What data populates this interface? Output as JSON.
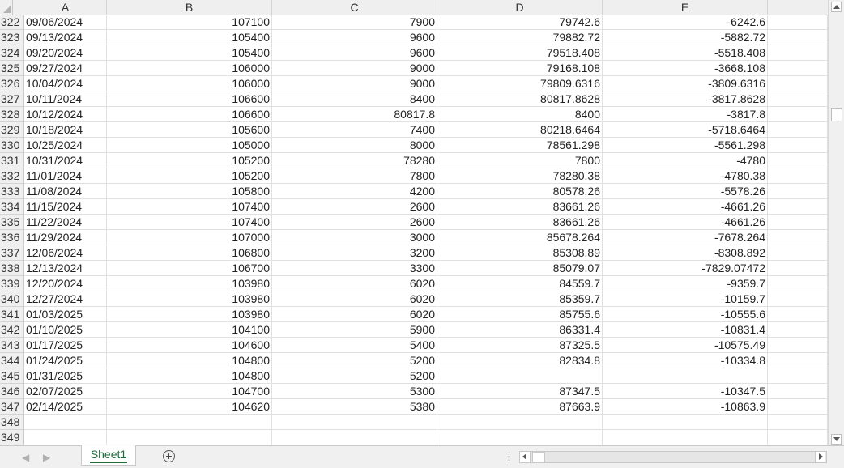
{
  "columns": [
    "A",
    "B",
    "C",
    "D",
    "E"
  ],
  "rows": [
    {
      "num": "322",
      "A": "09/06/2024",
      "B": "107100",
      "C": "7900",
      "D": "79742.6",
      "E": "-6242.6"
    },
    {
      "num": "323",
      "A": "09/13/2024",
      "B": "105400",
      "C": "9600",
      "D": "79882.72",
      "E": "-5882.72"
    },
    {
      "num": "324",
      "A": "09/20/2024",
      "B": "105400",
      "C": "9600",
      "D": "79518.408",
      "E": "-5518.408"
    },
    {
      "num": "325",
      "A": "09/27/2024",
      "B": "106000",
      "C": "9000",
      "D": "79168.108",
      "E": "-3668.108"
    },
    {
      "num": "326",
      "A": "10/04/2024",
      "B": "106000",
      "C": "9000",
      "D": "79809.6316",
      "E": "-3809.6316"
    },
    {
      "num": "327",
      "A": "10/11/2024",
      "B": "106600",
      "C": "8400",
      "D": "80817.8628",
      "E": "-3817.8628"
    },
    {
      "num": "328",
      "A": "10/12/2024",
      "B": "106600",
      "C": "80817.8",
      "D": "8400",
      "E": "-3817.8"
    },
    {
      "num": "329",
      "A": "10/18/2024",
      "B": "105600",
      "C": "7400",
      "D": "80218.6464",
      "E": "-5718.6464"
    },
    {
      "num": "330",
      "A": "10/25/2024",
      "B": "105000",
      "C": "8000",
      "D": "78561.298",
      "E": "-5561.298"
    },
    {
      "num": "331",
      "A": "10/31/2024",
      "B": "105200",
      "C": "78280",
      "D": "7800",
      "E": "-4780"
    },
    {
      "num": "332",
      "A": "11/01/2024",
      "B": "105200",
      "C": "7800",
      "D": "78280.38",
      "E": "-4780.38"
    },
    {
      "num": "333",
      "A": "11/08/2024",
      "B": "105800",
      "C": "4200",
      "D": "80578.26",
      "E": "-5578.26"
    },
    {
      "num": "334",
      "A": "11/15/2024",
      "B": "107400",
      "C": "2600",
      "D": "83661.26",
      "E": "-4661.26"
    },
    {
      "num": "335",
      "A": "11/22/2024",
      "B": "107400",
      "C": "2600",
      "D": "83661.26",
      "E": "-4661.26"
    },
    {
      "num": "336",
      "A": "11/29/2024",
      "B": "107000",
      "C": "3000",
      "D": "85678.264",
      "E": "-7678.264"
    },
    {
      "num": "337",
      "A": "12/06/2024",
      "B": "106800",
      "C": "3200",
      "D": "85308.89",
      "E": "-8308.892"
    },
    {
      "num": "338",
      "A": "12/13/2024",
      "B": "106700",
      "C": "3300",
      "D": "85079.07",
      "E": "-7829.07472"
    },
    {
      "num": "339",
      "A": "12/20/2024",
      "B": "103980",
      "C": "6020",
      "D": "84559.7",
      "E": "-9359.7"
    },
    {
      "num": "340",
      "A": "12/27/2024",
      "B": "103980",
      "C": "6020",
      "D": "85359.7",
      "E": "-10159.7"
    },
    {
      "num": "341",
      "A": "01/03/2025",
      "B": "103980",
      "C": "6020",
      "D": "85755.6",
      "E": "-10555.6"
    },
    {
      "num": "342",
      "A": "01/10/2025",
      "B": "104100",
      "C": "5900",
      "D": "86331.4",
      "E": "-10831.4"
    },
    {
      "num": "343",
      "A": "01/17/2025",
      "B": "104600",
      "C": "5400",
      "D": "87325.5",
      "E": "-10575.49"
    },
    {
      "num": "344",
      "A": "01/24/2025",
      "B": "104800",
      "C": "5200",
      "D": "82834.8",
      "E": "-10334.8"
    },
    {
      "num": "345",
      "A": "01/31/2025",
      "B": "104800",
      "C": "5200",
      "D": "",
      "E": ""
    },
    {
      "num": "346",
      "A": "02/07/2025",
      "B": "104700",
      "C": "5300",
      "D": "87347.5",
      "E": "-10347.5"
    },
    {
      "num": "347",
      "A": "02/14/2025",
      "B": "104620",
      "C": "5380",
      "D": "87663.9",
      "E": "-10863.9"
    },
    {
      "num": "348",
      "A": "",
      "B": "",
      "C": "",
      "D": "",
      "E": ""
    },
    {
      "num": "349",
      "A": "",
      "B": "",
      "C": "",
      "D": "",
      "E": ""
    }
  ],
  "sheet_tabs": [
    "Sheet1"
  ],
  "icons": {
    "add_sheet": "plus-circle-icon",
    "prev_sheet": "chevron-left-icon",
    "next_sheet": "chevron-right-icon",
    "more": "vertical-ellipsis-icon"
  },
  "colors": {
    "active_tab_text": "#1d6e3b",
    "header_bg": "#efefef",
    "grid_line": "#e0e0e0"
  }
}
